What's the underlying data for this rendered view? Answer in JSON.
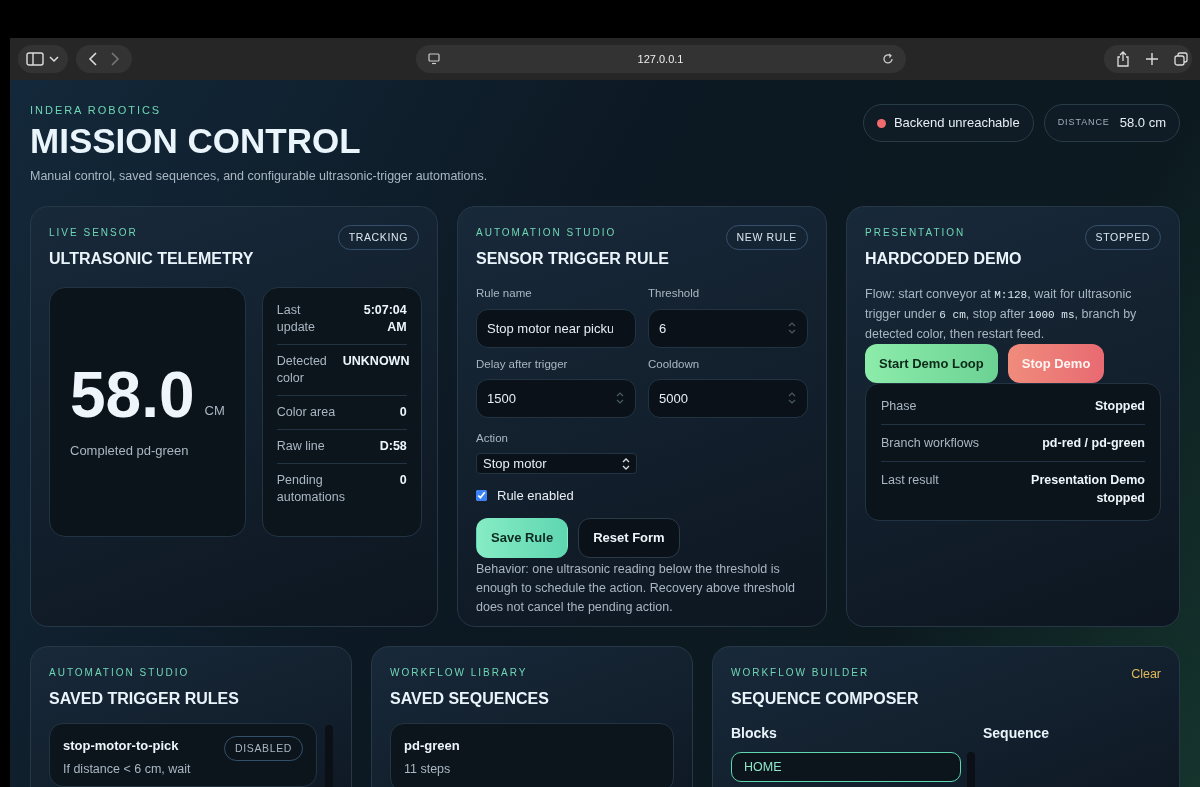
{
  "browser": {
    "url": "127.0.0.1"
  },
  "header": {
    "eyebrow": "INDERA ROBOTICS",
    "title": "MISSION CONTROL",
    "subtitle": "Manual control, saved sequences, and configurable ultrasonic-trigger automations.",
    "status": {
      "label": "Backend unreachable",
      "color": "#f06b6b"
    },
    "distance": {
      "label": "DISTANCE",
      "value": "58.0 cm"
    }
  },
  "telemetry": {
    "eyebrow": "LIVE SENSOR",
    "title": "ULTRASONIC TELEMETRY",
    "badge": "TRACKING",
    "reading": "58.0",
    "unit": "CM",
    "caption": "Completed pd-green",
    "stats": [
      {
        "label": "Last update",
        "value": "5:07:04 AM"
      },
      {
        "label": "Detected color",
        "value": "UNKNOWN"
      },
      {
        "label": "Color area",
        "value": "0"
      },
      {
        "label": "Raw line",
        "value": "D:58"
      },
      {
        "label": "Pending automations",
        "value": "0"
      }
    ]
  },
  "rule_form": {
    "eyebrow": "AUTOMATION STUDIO",
    "title": "SENSOR TRIGGER RULE",
    "badge": "NEW RULE",
    "fields": [
      {
        "label": "Rule name",
        "value": "Stop motor near picku",
        "kind": "text"
      },
      {
        "label": "Threshold",
        "value": "6",
        "kind": "number"
      },
      {
        "label": "Delay after trigger",
        "value": "1500",
        "kind": "number"
      },
      {
        "label": "Cooldown",
        "value": "5000",
        "kind": "number"
      }
    ],
    "action": {
      "label": "Action",
      "value": "Stop motor"
    },
    "enabled": {
      "label": "Rule enabled",
      "checked": true
    },
    "buttons": [
      {
        "label": "Save Rule",
        "kind": "primary"
      },
      {
        "label": "Reset Form",
        "kind": "secondary"
      }
    ],
    "note": "Behavior: one ultrasonic reading below the threshold is enough to schedule the action. Recovery above threshold does not cancel the pending action."
  },
  "demo": {
    "eyebrow": "PRESENTATION",
    "title": "HARDCODED DEMO",
    "badge": "STOPPED",
    "flow": [
      {
        "kind": "text",
        "text": "Flow: start conveyor at "
      },
      {
        "kind": "code",
        "text": "M:128"
      },
      {
        "kind": "text",
        "text": ", wait for ultrasonic trigger under "
      },
      {
        "kind": "code",
        "text": "6 cm"
      },
      {
        "kind": "text",
        "text": ", stop after "
      },
      {
        "kind": "code",
        "text": "1000 ms"
      },
      {
        "kind": "text",
        "text": ", branch by detected color, then restart feed."
      }
    ],
    "buttons": [
      {
        "label": "Start Demo Loop",
        "kind": "start"
      },
      {
        "label": "Stop Demo",
        "kind": "stop"
      }
    ],
    "stats": [
      {
        "label": "Phase",
        "value": "Stopped"
      },
      {
        "label": "Branch workflows",
        "value": "pd-red / pd-green"
      },
      {
        "label": "Last result",
        "value": "Presentation Demo stopped"
      }
    ]
  },
  "saved_rules": {
    "eyebrow": "AUTOMATION STUDIO",
    "title": "SAVED TRIGGER RULES",
    "rules": [
      {
        "name": "stop-motor-to-pick",
        "badge": "DISABLED",
        "description": "If distance < 6 cm, wait"
      }
    ]
  },
  "sequences": {
    "eyebrow": "WORKFLOW LIBRARY",
    "title": "SAVED SEQUENCES",
    "items": [
      {
        "name": "pd-green",
        "steps": "11 steps"
      }
    ]
  },
  "composer": {
    "eyebrow": "WORKFLOW BUILDER",
    "title": "SEQUENCE COMPOSER",
    "clear": "Clear",
    "blocks_label": "Blocks",
    "sequence_label": "Sequence",
    "blocks": [
      "HOME"
    ]
  }
}
